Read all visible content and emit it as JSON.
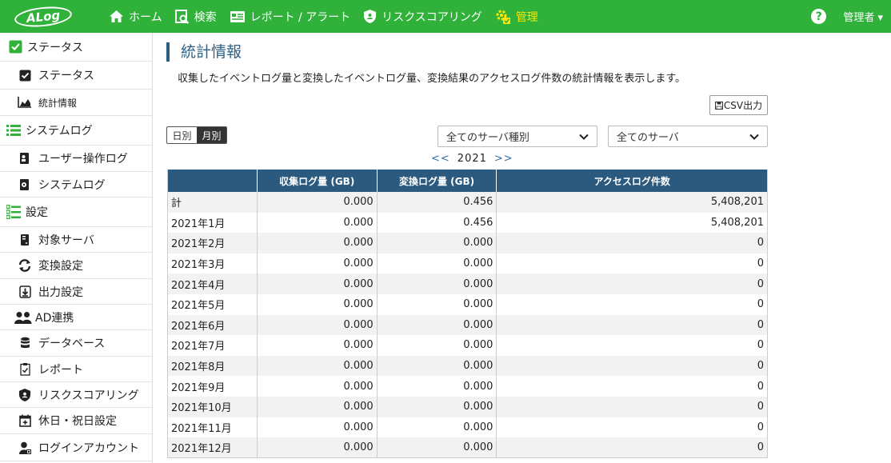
{
  "header": {
    "logo_text": "ALog",
    "nav": [
      {
        "label": "ホーム",
        "icon": "home-icon"
      },
      {
        "label": "検索",
        "icon": "search-doc-icon"
      },
      {
        "label": "レポート / アラート",
        "icon": "report-icon"
      },
      {
        "label": "リスクスコアリング",
        "icon": "shield-icon"
      },
      {
        "label": "管理",
        "icon": "gear-manage-icon",
        "active": true
      }
    ],
    "help": "?",
    "user": "管理者 ▾"
  },
  "sidebar": {
    "status": {
      "label": "ステータス",
      "items": [
        {
          "label": "ステータス",
          "icon": "checkbox-icon"
        },
        {
          "label": "統計情報",
          "icon": "area-chart-icon"
        }
      ]
    },
    "syslog": {
      "label": "システムログ",
      "items": [
        {
          "label": "ユーザー操作ログ",
          "icon": "user-log-icon"
        },
        {
          "label": "システムログ",
          "icon": "system-log-icon"
        }
      ]
    },
    "settings": {
      "label": "設定",
      "items": [
        {
          "label": "対象サーバ",
          "icon": "server-icon"
        },
        {
          "label": "変換設定",
          "icon": "refresh-icon"
        },
        {
          "label": "出力設定",
          "icon": "download-icon"
        },
        {
          "label": "AD連携",
          "icon": "users-icon"
        },
        {
          "label": "データベース",
          "icon": "database-icon"
        },
        {
          "label": "レポート",
          "icon": "report-check-icon"
        },
        {
          "label": "リスクスコアリング",
          "icon": "shield-icon"
        },
        {
          "label": "休日・祝日設定",
          "icon": "calendar-icon"
        },
        {
          "label": "ログインアカウント",
          "icon": "account-icon"
        }
      ]
    }
  },
  "main": {
    "title": "統計情報",
    "description": "収集したイベントログ量と変換したイベントログ量、変換結果のアクセスログ件数の統計情報を表示します。",
    "csv_button": "CSV出力",
    "toggle": {
      "daily": "日別",
      "monthly": "月別",
      "selected": "monthly"
    },
    "server_type_select": "全てのサーバ種別",
    "server_select": "全てのサーバ",
    "year_nav": {
      "prev": "<<",
      "year": "2021",
      "next": ">>"
    },
    "table": {
      "columns": [
        "",
        "収集ログ量 (GB)",
        "変換ログ量 (GB)",
        "アクセスログ件数"
      ],
      "rows": [
        [
          "計",
          "0.000",
          "0.456",
          "5,408,201"
        ],
        [
          "2021年1月",
          "0.000",
          "0.456",
          "5,408,201"
        ],
        [
          "2021年2月",
          "0.000",
          "0.000",
          "0"
        ],
        [
          "2021年3月",
          "0.000",
          "0.000",
          "0"
        ],
        [
          "2021年4月",
          "0.000",
          "0.000",
          "0"
        ],
        [
          "2021年5月",
          "0.000",
          "0.000",
          "0"
        ],
        [
          "2021年6月",
          "0.000",
          "0.000",
          "0"
        ],
        [
          "2021年7月",
          "0.000",
          "0.000",
          "0"
        ],
        [
          "2021年8月",
          "0.000",
          "0.000",
          "0"
        ],
        [
          "2021年9月",
          "0.000",
          "0.000",
          "0"
        ],
        [
          "2021年10月",
          "0.000",
          "0.000",
          "0"
        ],
        [
          "2021年11月",
          "0.000",
          "0.000",
          "0"
        ],
        [
          "2021年12月",
          "0.000",
          "0.000",
          "0"
        ]
      ]
    }
  },
  "colors": {
    "topbar": "#2fb13a",
    "active_nav": "#ffe600",
    "table_header": "#2c5a7e",
    "title": "#2c5f84"
  }
}
